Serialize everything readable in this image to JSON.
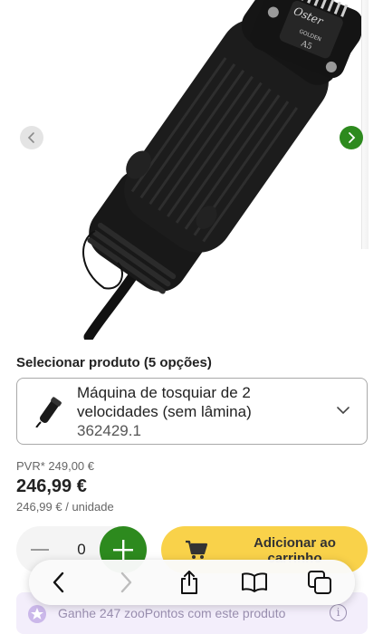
{
  "gallery": {
    "brand_text": "Oster",
    "model_text": "A5",
    "series_text": "GOLDEN",
    "prev_icon": "chevron-left-icon",
    "next_icon": "chevron-right-icon"
  },
  "selector": {
    "label": "Selecionar produto (5 opções)",
    "variant_name": "Máquina de tosquiar de 2 velocidades (sem lâmina)",
    "variant_sku": "362429.1"
  },
  "pricing": {
    "pvr": "PVR* 249,00 €",
    "price": "246,99 €",
    "unit_price": "246,99 € / unidade"
  },
  "quantity": {
    "value": "0"
  },
  "cart": {
    "label": "Adicionar ao carrinho"
  },
  "points": {
    "text": "Ganhe 247 zooPontos com este produto",
    "info": "i"
  },
  "colors": {
    "accent_green": "#2d8a1e",
    "cart_yellow": "#f9d24a",
    "points_bg": "#f3eefb"
  }
}
